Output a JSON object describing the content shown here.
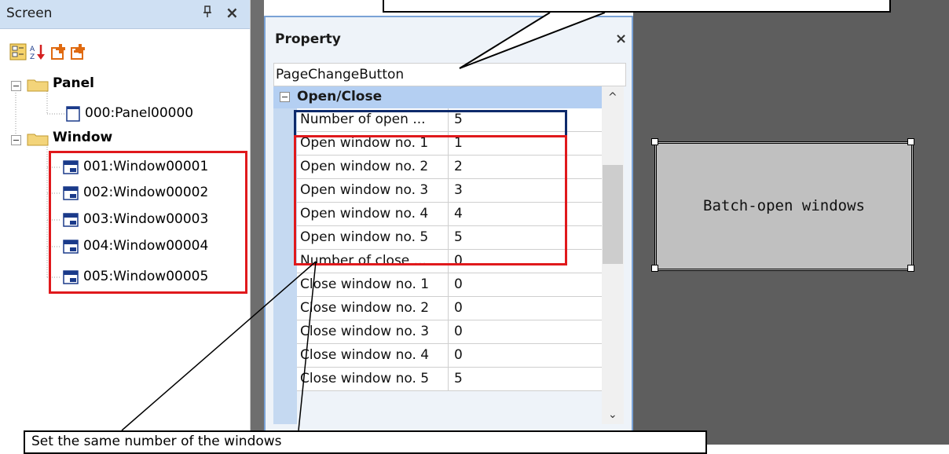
{
  "screen_panel": {
    "title": "Screen",
    "pin_icon": "pin-icon",
    "close_glyph": "×",
    "toolbar_icons": [
      "categorized-view-icon",
      "sort-icon",
      "add-screen-icon",
      "add-window-icon"
    ],
    "tree": {
      "panel_group": "Panel",
      "panel_items": [
        "000:Panel00000"
      ],
      "window_group": "Window",
      "window_items": [
        "001:Window00001",
        "002:Window00002",
        "003:Window00003",
        "004:Window00004",
        "005:Window00005"
      ]
    }
  },
  "property_panel": {
    "title": "Property",
    "close_glyph": "×",
    "object_name": "PageChangeButton",
    "category": "Open/Close",
    "rows": [
      {
        "name": "Number of open ...",
        "value": "5"
      },
      {
        "name": "Open window no. 1",
        "value": "1"
      },
      {
        "name": "Open window no. 2",
        "value": "2"
      },
      {
        "name": "Open window no. 3",
        "value": "3"
      },
      {
        "name": "Open window no. 4",
        "value": "4"
      },
      {
        "name": "Open window no. 5",
        "value": "5"
      },
      {
        "name": "Number of close ...",
        "value": "0"
      },
      {
        "name": "Close window no. 1",
        "value": "0"
      },
      {
        "name": "Close window no. 2",
        "value": "0"
      },
      {
        "name": "Close window no. 3",
        "value": "0"
      },
      {
        "name": "Close window no. 4",
        "value": "0"
      },
      {
        "name": "Close window no. 5",
        "value": "5"
      }
    ],
    "scroll_up_glyph": "^",
    "scroll_down_glyph": "⌄"
  },
  "canvas": {
    "button_label": "Batch-open windows"
  },
  "callouts": {
    "bottom_text": "Set the same number of the windows"
  },
  "colors": {
    "highlight_red": "#e0191c",
    "highlight_navy": "#0e2a6b",
    "category_blue": "#b4cff2",
    "canvas_gray": "#5e5e5e"
  }
}
